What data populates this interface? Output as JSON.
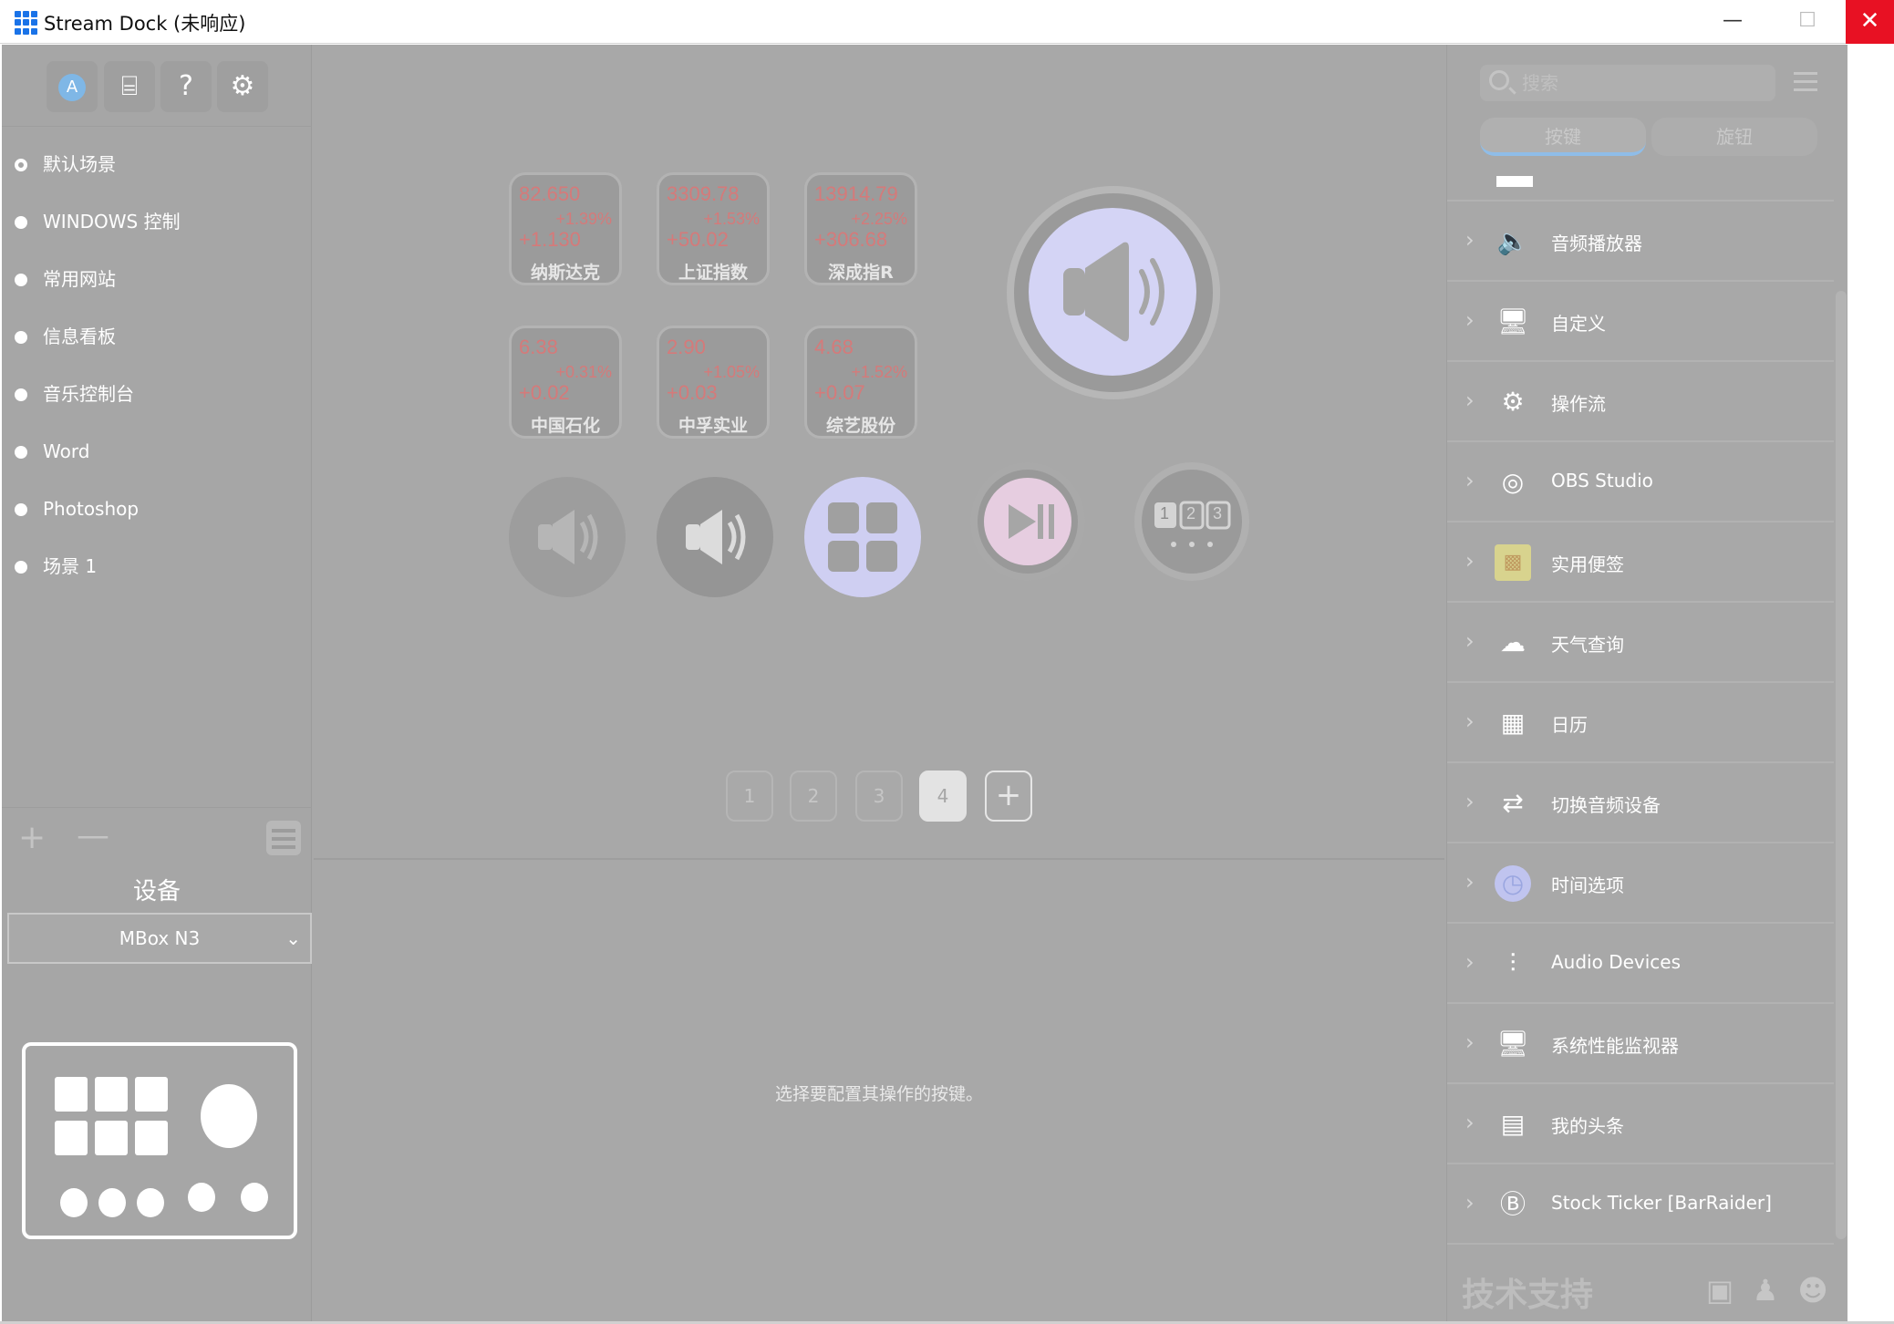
{
  "window": {
    "title": "Stream Dock (未响应)",
    "min_glyph": "—",
    "max_glyph": "☐",
    "close_glyph": "✕"
  },
  "toolbar": {
    "store_icon": "app-store-icon",
    "store_glyph": "A",
    "present_icon": "presentation-icon",
    "present_glyph": "⌸",
    "help_icon": "help-icon",
    "help_glyph": "?",
    "settings_icon": "gear-icon",
    "settings_glyph": "⚙"
  },
  "scenes": [
    {
      "label": "默认场景",
      "selected": true
    },
    {
      "label": "WINDOWS 控制",
      "selected": false
    },
    {
      "label": "常用网站",
      "selected": false
    },
    {
      "label": "信息看板",
      "selected": false
    },
    {
      "label": "音乐控制台",
      "selected": false
    },
    {
      "label": "Word",
      "selected": false
    },
    {
      "label": "Photoshop",
      "selected": false
    },
    {
      "label": "场景 1",
      "selected": false
    }
  ],
  "scene_actions": {
    "add": "+",
    "remove": "—"
  },
  "device": {
    "label": "设备",
    "selected": "MBox N3",
    "chevron": "⌄"
  },
  "keys": [
    {
      "price": "82.650",
      "pct": "+1.39%",
      "chg": "+1.130",
      "name": "纳斯达克"
    },
    {
      "price": "3309.78",
      "pct": "+1.53%",
      "chg": "+50.02",
      "name": "上证指数"
    },
    {
      "price": "13914.79",
      "pct": "+2.25%",
      "chg": "+306.68",
      "name": "深成指R"
    },
    {
      "price": "6.38",
      "pct": "+0.31%",
      "chg": "+0.02",
      "name": "中国石化"
    },
    {
      "price": "2.90",
      "pct": "+1.05%",
      "chg": "+0.03",
      "name": "中孚实业"
    },
    {
      "price": "4.68",
      "pct": "+1.52%",
      "chg": "+0.07",
      "name": "综艺股份"
    }
  ],
  "round_keys": {
    "volume_down_icon": "volume-down-icon",
    "volume_up_icon": "volume-up-icon",
    "folder_icon": "grid-folder-icon",
    "play_pause_icon": "play-pause-icon",
    "page_icon": "page-selector-icon",
    "page_digits": [
      "1",
      "2",
      "3"
    ],
    "big_knob_icon": "speaker-icon"
  },
  "pager": {
    "pages": [
      "1",
      "2",
      "3",
      "4"
    ],
    "active": 4,
    "add": "+"
  },
  "hint": "选择要配置其操作的按键。",
  "right": {
    "search_placeholder": "搜索",
    "tabs": [
      "按键",
      "旋钮"
    ],
    "plugins": [
      {
        "name": "音频播放器",
        "icon": "speaker-icon",
        "glyph": "🔈"
      },
      {
        "name": "自定义",
        "icon": "monitor-search-icon",
        "glyph": "🖥"
      },
      {
        "name": "操作流",
        "icon": "workflow-icon",
        "glyph": "⚙"
      },
      {
        "name": "OBS Studio",
        "icon": "obs-icon",
        "glyph": "◎"
      },
      {
        "name": "实用便签",
        "icon": "sticky-note-icon",
        "glyph": "▩"
      },
      {
        "name": "天气查询",
        "icon": "weather-icon",
        "glyph": "☁"
      },
      {
        "name": "日历",
        "icon": "calendar-icon",
        "glyph": "▦"
      },
      {
        "name": "切换音频设备",
        "icon": "audio-switch-icon",
        "glyph": "⇄"
      },
      {
        "name": "时间选项",
        "icon": "clock-icon",
        "glyph": "◷"
      },
      {
        "name": "Audio Devices",
        "icon": "equalizer-icon",
        "glyph": "⫶"
      },
      {
        "name": "系统性能监视器",
        "icon": "system-monitor-icon",
        "glyph": "🖥"
      },
      {
        "name": "我的头条",
        "icon": "news-icon",
        "glyph": "▤"
      },
      {
        "name": "Stock Ticker [BarRaider]",
        "icon": "barraider-icon",
        "glyph": "Ⓑ"
      }
    ],
    "support_label": "技术支持"
  },
  "colors": {
    "close_red": "#e81123",
    "accent_blue": "#1a73e8",
    "stock_red": "#d57a7a",
    "knob_lavender": "#d4d4f5"
  }
}
